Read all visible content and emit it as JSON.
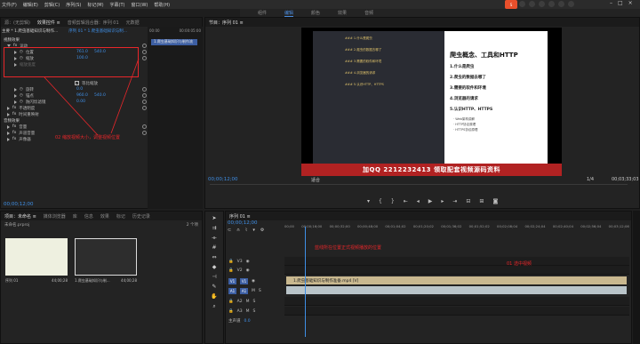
{
  "menu": [
    "文件(F)",
    "编辑(E)",
    "剪辑(C)",
    "序列(S)",
    "标记(M)",
    "字幕(T)",
    "窗口(W)",
    "帮助(H)"
  ],
  "workspaces": {
    "items": [
      "组件",
      "编辑",
      "颜色",
      "效果",
      "音频"
    ],
    "active_index": 1
  },
  "ec_panel": {
    "tabs": [
      "源：(无剪辑)",
      "效果控件 ≡",
      "音频剪辑混合器：序列 01",
      "元数据"
    ],
    "clip_path": "主要 * 1.爬虫基础知识与制作...",
    "sequence_path": "序列 01 * 1.爬虫基础知识与制...",
    "mini_times": [
      "00:00",
      "00:00:05:00"
    ],
    "mini_clip": "1.爬虫基础知识与制作流",
    "video_effects_label": "视频效果",
    "motion_label": "运动",
    "position_label": "位置",
    "position_x": "761.0",
    "position_y": "540.0",
    "scale_label": "缩放",
    "scale_value": "100.0",
    "scale_width_label": "缩放宽度",
    "uniform_scale_label": "等比缩放",
    "rotation_label": "旋转",
    "rotation_value": "0.0",
    "anchor_label": "锚点",
    "anchor_x": "960.0",
    "anchor_y": "540.0",
    "flicker_label": "防闪烁滤镜",
    "flicker_value": "0.00",
    "opacity_label": "不透明度",
    "remap_label": "时间重映射",
    "audio_effects_label": "音频效果",
    "volume_label": "音量",
    "channel_volume_label": "声道音量",
    "panner_label": "声像器",
    "annotation": "02 缩放视频大小，调整视频位置",
    "timecode": "00;00;12;00"
  },
  "program": {
    "tab": "节目：序列 01 ≡",
    "timecode_left": "00;00;12;00",
    "fit": "适合",
    "scale": "1/4",
    "timecode_right": "00;03;33;03",
    "promo_text": "加QQ 2212232413  领取配套视频源码资料",
    "slide_title": "爬虫概念、工具和HTTP",
    "slide_items": [
      "1.什么是爬虫",
      "2.爬虫的数据去哪了",
      "3.需要的软件和环境",
      "4.浏览器的请求",
      "5.认识HTTP、HTTPS"
    ],
    "slide_small": [
      "· Web架构讲解",
      "· HTTP协议原理",
      "· HTTPS协议原理"
    ],
    "sidebar_items": [
      "### 1.什么是爬虫",
      "### 2.爬虫的数据去哪了",
      "### 3.需要的软件和环境",
      "### 4.浏览器的请求",
      "### 5.认识HTTP、HTTPS"
    ]
  },
  "project": {
    "tabs": [
      "项目：未命名 ≡",
      "媒体浏览器",
      "库",
      "信息",
      "效果",
      "标记",
      "历史记录"
    ],
    "project_name": "未命名.prproj",
    "count": "2 个项",
    "item1_name": "序列 01",
    "item1_duration": "44;00;28",
    "item2_name": "1.爬虫基础知识与制...",
    "item2_duration": "44;00;28"
  },
  "timeline": {
    "tab": "序列 01 ≡",
    "timecode": "00;00;12;00",
    "ruler": [
      "00;00",
      "00;00;16;00",
      "00;00;32;00",
      "00;00;48;00",
      "00;01;04;02",
      "00;01;20;02",
      "00;01;36;02",
      "00;01;52;02",
      "00;02;08;04",
      "00;02;24;04",
      "00;02;40;04",
      "00;02;56;04",
      "00;03;12;06"
    ],
    "tracks": [
      "V3",
      "V2",
      "V1",
      "A1",
      "A2",
      "A3"
    ],
    "master_label": "主声道",
    "master_value": "0.0",
    "video_clip": "1.爬虫基础知识与制作准备.mp4 [V]",
    "annotation_playhead": "蓝线所在位置正式视频播放的位置",
    "annotation_select": "01 选中视频"
  },
  "colors": {
    "accent": "#3f8fe6",
    "annotation": "#e8262a",
    "promo": "#b12222",
    "video_clip": "#c9b88f",
    "audio_clip": "#b9c4c9"
  }
}
